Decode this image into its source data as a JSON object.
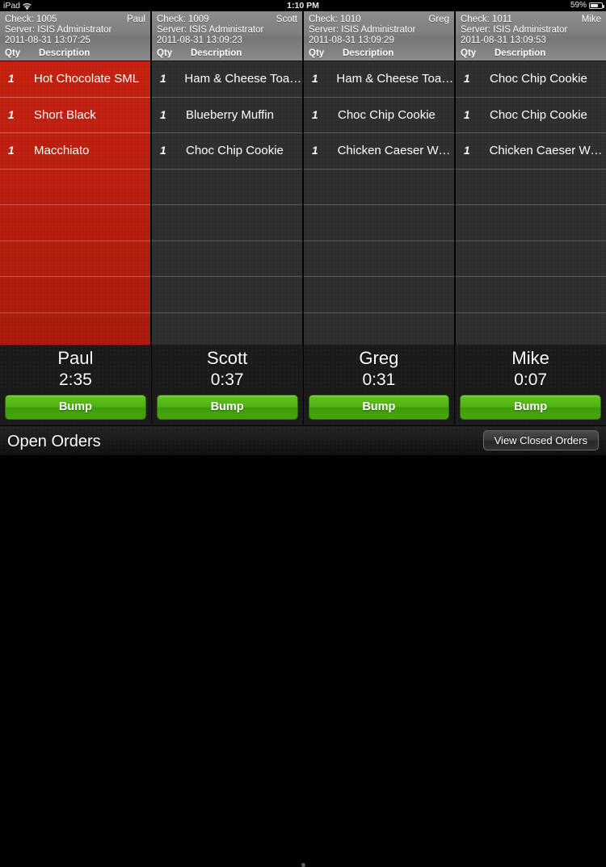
{
  "status_bar": {
    "device": "iPad",
    "wifi_icon": "wifi-icon",
    "time": "1:10 PM",
    "battery_percent": "59%",
    "battery_icon": "battery-icon"
  },
  "columns": [
    {
      "check_label": "Check: 1005",
      "customer": "Paul",
      "server": "Server: ISIS Administrator",
      "timestamp": "2011-08-31 13:07:25",
      "qty_header": "Qty",
      "desc_header": "Description",
      "state": "active",
      "accent": "#b81c0d",
      "items": [
        {
          "qty": "1",
          "description": "Hot Chocolate SML"
        },
        {
          "qty": "1",
          "description": "Short Black"
        },
        {
          "qty": "1",
          "description": "Macchiato"
        }
      ],
      "empty_rows": 5,
      "footer_name": "Paul",
      "timer": "2:35",
      "bump_label": "Bump"
    },
    {
      "check_label": "Check: 1009",
      "customer": "Scott",
      "server": "Server: ISIS Administrator",
      "timestamp": "2011-08-31 13:09:23",
      "qty_header": "Qty",
      "desc_header": "Description",
      "state": "idle",
      "accent": "#2e2e2e",
      "items": [
        {
          "qty": "1",
          "description": "Ham & Cheese Toastie"
        },
        {
          "qty": "1",
          "description": "Blueberry Muffin"
        },
        {
          "qty": "1",
          "description": "Choc Chip Cookie"
        }
      ],
      "empty_rows": 5,
      "footer_name": "Scott",
      "timer": "0:37",
      "bump_label": "Bump"
    },
    {
      "check_label": "Check: 1010",
      "customer": "Greg",
      "server": "Server: ISIS Administrator",
      "timestamp": "2011-08-31 13:09:29",
      "qty_header": "Qty",
      "desc_header": "Description",
      "state": "idle",
      "accent": "#2e2e2e",
      "items": [
        {
          "qty": "1",
          "description": "Ham & Cheese Toastie"
        },
        {
          "qty": "1",
          "description": "Choc Chip Cookie"
        },
        {
          "qty": "1",
          "description": "Chicken Caeser Wrap"
        }
      ],
      "empty_rows": 5,
      "footer_name": "Greg",
      "timer": "0:31",
      "bump_label": "Bump"
    },
    {
      "check_label": "Check: 1011",
      "customer": "Mike",
      "server": "Server: ISIS Administrator",
      "timestamp": "2011-08-31 13:09:53",
      "qty_header": "Qty",
      "desc_header": "Description",
      "state": "idle",
      "accent": "#2e2e2e",
      "items": [
        {
          "qty": "1",
          "description": "Choc Chip Cookie"
        },
        {
          "qty": "1",
          "description": "Choc Chip Cookie"
        },
        {
          "qty": "1",
          "description": "Chicken Caeser Wrap"
        }
      ],
      "empty_rows": 5,
      "footer_name": "Mike",
      "timer": "0:07",
      "bump_label": "Bump"
    }
  ],
  "toolbar": {
    "title": "Open Orders",
    "view_closed_label": "View Closed Orders",
    "page_dots": 1,
    "active_page": 1
  },
  "colors": {
    "active_order": "#b81c0d",
    "bump_green": "#4fb012",
    "header_gray": "#808080",
    "panel_dark": "#2e2e2e"
  }
}
